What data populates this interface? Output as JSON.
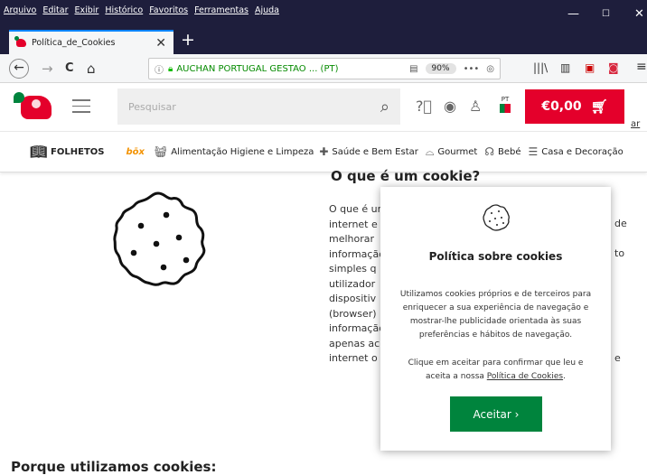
{
  "browser": {
    "menu": [
      "Arquivo",
      "Editar",
      "Exibir",
      "Histórico",
      "Favoritos",
      "Ferramentas",
      "Ajuda"
    ],
    "window_controls": {
      "minimize": "—",
      "maximize": "☐",
      "close": "✕"
    },
    "tab": {
      "title": "Política_de_Cookies",
      "close": "✕"
    },
    "new_tab": "+",
    "nav": {
      "back": "←",
      "forward": "→",
      "reload": "C",
      "home": "⌂"
    },
    "url": {
      "info": "ⓘ",
      "org": "AUCHAN PORTUGAL GESTAO ... (PT)",
      "reader": "▤",
      "zoom": "90%",
      "more": "•••",
      "pocket": "◎"
    },
    "tools": {
      "library": "𝄃𝄃\\",
      "sidebar": "▥",
      "pdf": "▣",
      "pocket2": "◙",
      "menu": "≡"
    }
  },
  "site": {
    "search_placeholder": "Pesquisar",
    "cart_total": "€0,00",
    "flag_label": "PT",
    "cut_text": "ar",
    "categories": {
      "folhetos": "FOLHETOS",
      "box": "bōx",
      "alimentacao": "Alimentação Higiene e Limpeza",
      "saude": "Saúde e Bem Estar",
      "gourmet": "Gourmet",
      "bebe": "Bebé",
      "casa": "Casa e Decoração"
    }
  },
  "content": {
    "title": "O que é um cookie?",
    "body_lines": [
      "O que é um",
      "internet e",
      "melhorar",
      "informação",
      "simples q",
      "utilizador",
      "dispositiv",
      "(browser)",
      "informação",
      "apenas ac",
      "internet o"
    ],
    "right_fragments": [
      "de",
      "to",
      "e"
    ],
    "section_title": "Porque utilizamos cookies:"
  },
  "modal": {
    "title": "Política sobre cookies",
    "p1": "Utilizamos cookies próprios e de terceiros para enriquecer a sua experiência de navegação e mostrar-lhe publicidade orientada às suas preferências e hábitos de navegação.",
    "p2_before": "Clique em aceitar para confirmar que leu e aceita a nossa ",
    "p2_link": "Política de Cookies",
    "p2_after": ".",
    "accept": "Aceitar ›"
  }
}
